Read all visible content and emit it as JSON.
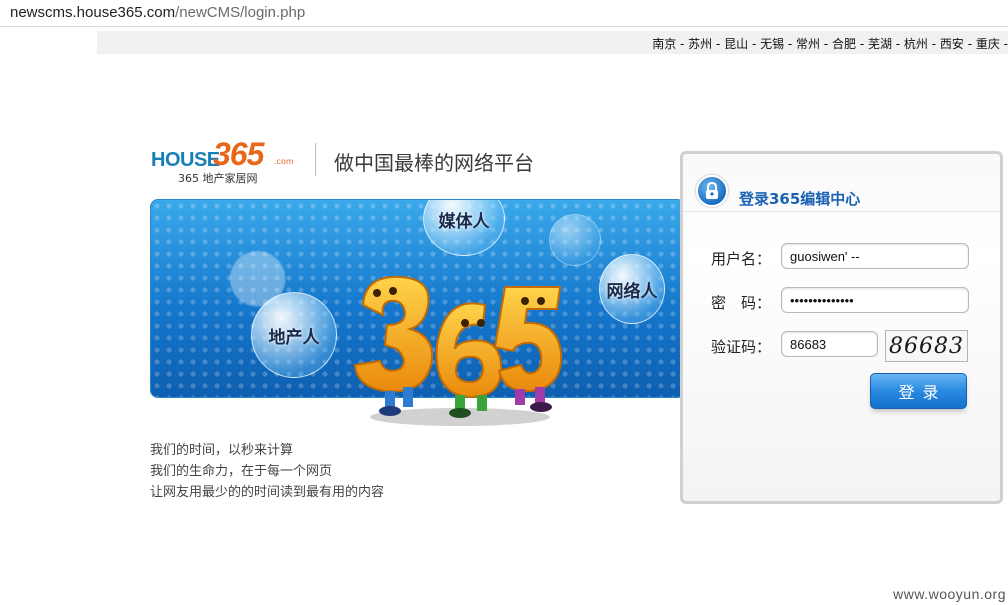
{
  "browser": {
    "url_host": "newscms.house365.com",
    "url_path": "/newCMS/login.php"
  },
  "city_nav": {
    "text": "南京 - 苏州 - 昆山 - 无锡 - 常州 - 合肥 - 芜湖 - 杭州 - 西安 - 重庆 -"
  },
  "header": {
    "logo_house": "HOUSE",
    "logo_number": "365",
    "logo_dotcom": ".com",
    "logo_subtitle": "365 地产家居网",
    "slogan": "做中国最棒的网络平台"
  },
  "banner": {
    "bubble_media": "媒体人",
    "bubble_network": "网络人",
    "bubble_estate": "地产人",
    "colors": {
      "sky": "#1577cc",
      "mascot": "#f5a623"
    }
  },
  "taglines": [
    "我们的时间，以秒来计算",
    "我们的生命力，在于每一个网页",
    "让网友用最少的的时间读到最有用的内容"
  ],
  "login": {
    "title": "登录365编辑中心",
    "username_label": "用户名：",
    "username_value": "guosiwen' --",
    "password_label": "密　码：",
    "password_value": "••••••••••••••",
    "captcha_label": "验证码：",
    "captcha_value": "86683",
    "captcha_image_text": "86683",
    "submit_label": "登录",
    "accent_color": "#1c62b3"
  },
  "watermark": "www.wooyun.org"
}
